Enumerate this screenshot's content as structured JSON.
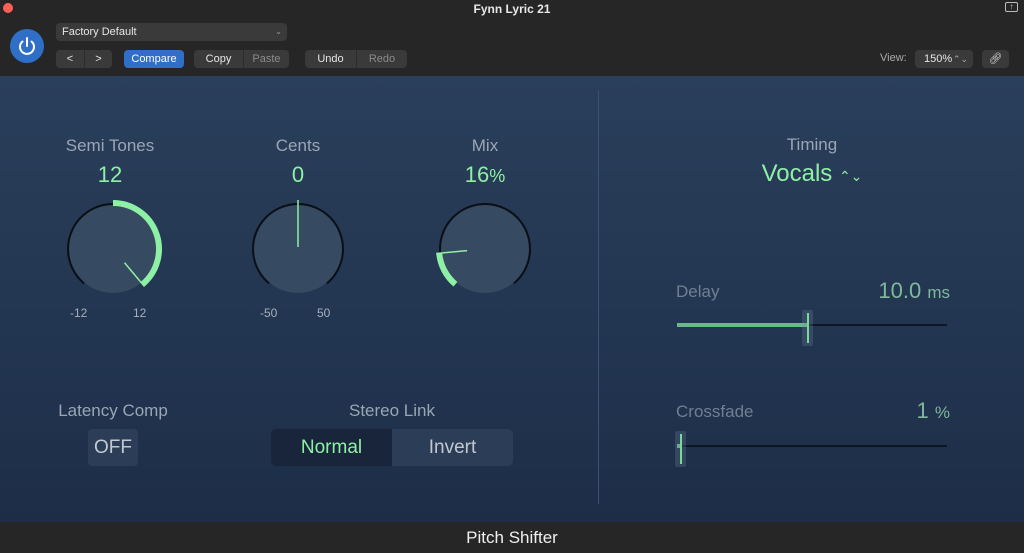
{
  "window": {
    "title": "Fynn Lyric 21"
  },
  "header": {
    "preset": "Factory Default",
    "nav": {
      "prev": "<",
      "next": ">"
    },
    "compare": "Compare",
    "copy": "Copy",
    "paste": "Paste",
    "undo": "Undo",
    "redo": "Redo",
    "view_label": "View:",
    "view_value": "150%"
  },
  "knobs": {
    "semitones": {
      "label": "Semi Tones",
      "value": "12",
      "min_label": "-12",
      "max_label": "12",
      "fraction": 1.0
    },
    "cents": {
      "label": "Cents",
      "value": "0",
      "min_label": "-50",
      "max_label": "50",
      "fraction": 0.5
    },
    "mix": {
      "label": "Mix",
      "value": "16",
      "unit": "%",
      "fraction": 0.16
    }
  },
  "timing": {
    "label": "Timing",
    "value": "Vocals"
  },
  "delay": {
    "label": "Delay",
    "value": "10.0",
    "unit": "ms",
    "fraction": 0.48
  },
  "crossfade": {
    "label": "Crossfade",
    "value": "1",
    "unit": "%",
    "fraction": 0.01
  },
  "latency": {
    "label": "Latency Comp",
    "value": "OFF"
  },
  "stereo_link": {
    "label": "Stereo Link",
    "options": [
      "Normal",
      "Invert"
    ],
    "selected": "Normal"
  },
  "footer": {
    "plugin_name": "Pitch Shifter"
  },
  "colors": {
    "accent": "#8ef0a4",
    "panel": "#253a55",
    "blue": "#2f6fc7"
  }
}
